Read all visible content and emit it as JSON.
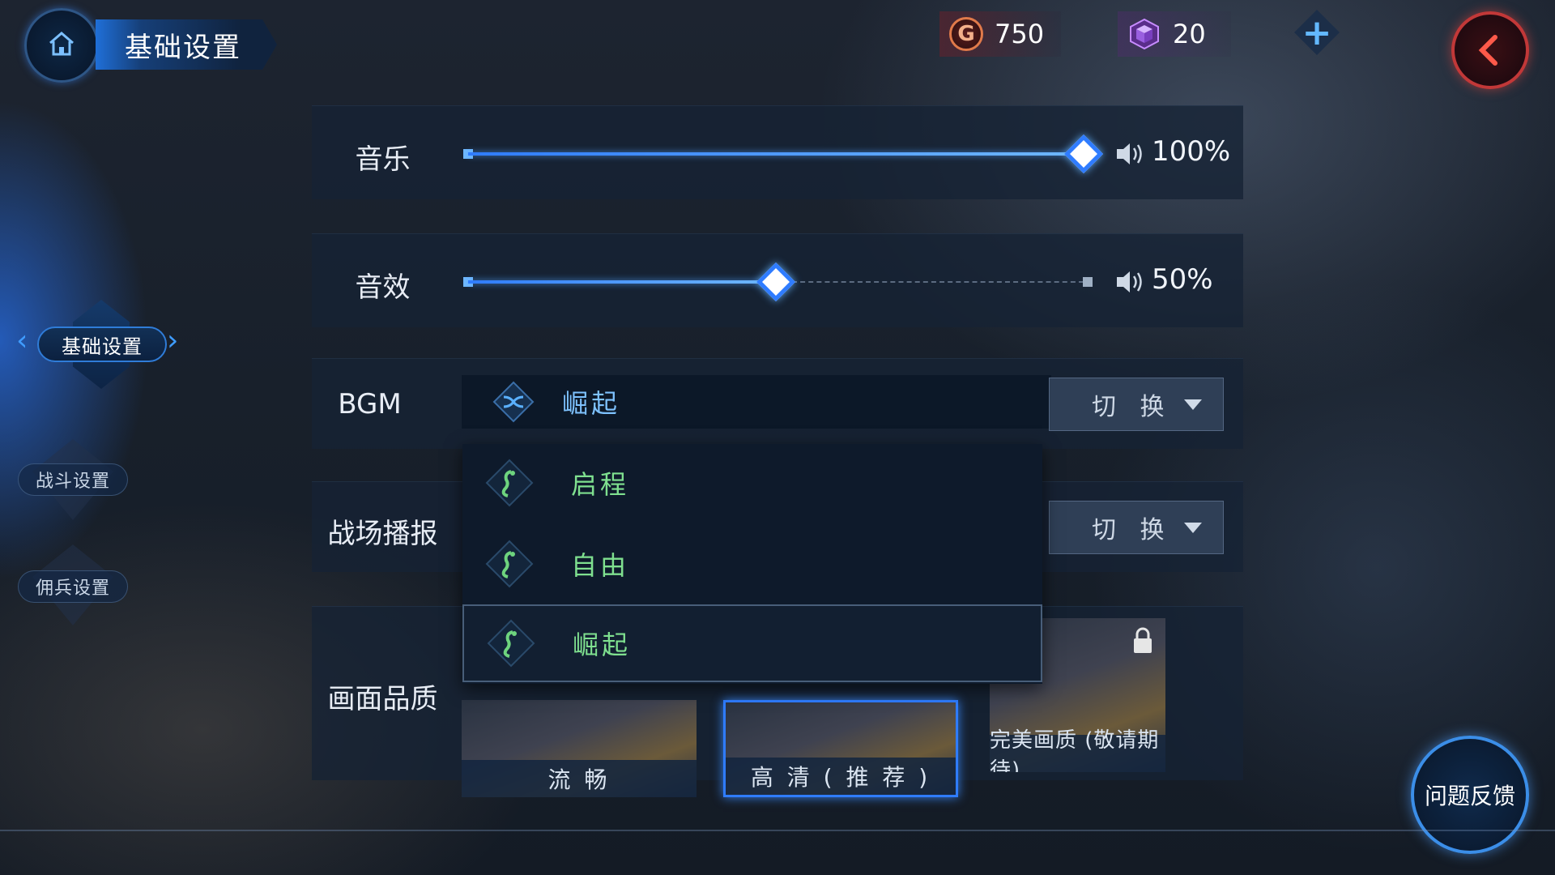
{
  "header": {
    "title": "基础设置",
    "gold": "750",
    "gold_symbol": "G",
    "gems": "20"
  },
  "nav": {
    "active": "基础设置",
    "items": [
      "战斗设置",
      "佣兵设置"
    ]
  },
  "settings": {
    "music": {
      "label": "音乐",
      "value": "100%",
      "level": 1.0
    },
    "sfx": {
      "label": "音效",
      "value": "50%",
      "level": 0.5
    },
    "bgm": {
      "label": "BGM",
      "current": "崛起",
      "switch": "切 换"
    },
    "broadcast": {
      "label": "战场播报",
      "switch": "切 换"
    },
    "quality": {
      "label": "画面品质",
      "options": [
        "流 畅",
        "高 清 ( 推 荐 )",
        "完美画质 (敬请期待)"
      ],
      "selected": 1
    }
  },
  "dropdown": {
    "options": [
      "启程",
      "自由",
      "崛起"
    ],
    "selected": 2
  },
  "feedback": {
    "label": "问题反馈"
  },
  "colors": {
    "accent": "#2f7cff",
    "dropdown_text": "#7fe08f",
    "back": "#c23838"
  }
}
